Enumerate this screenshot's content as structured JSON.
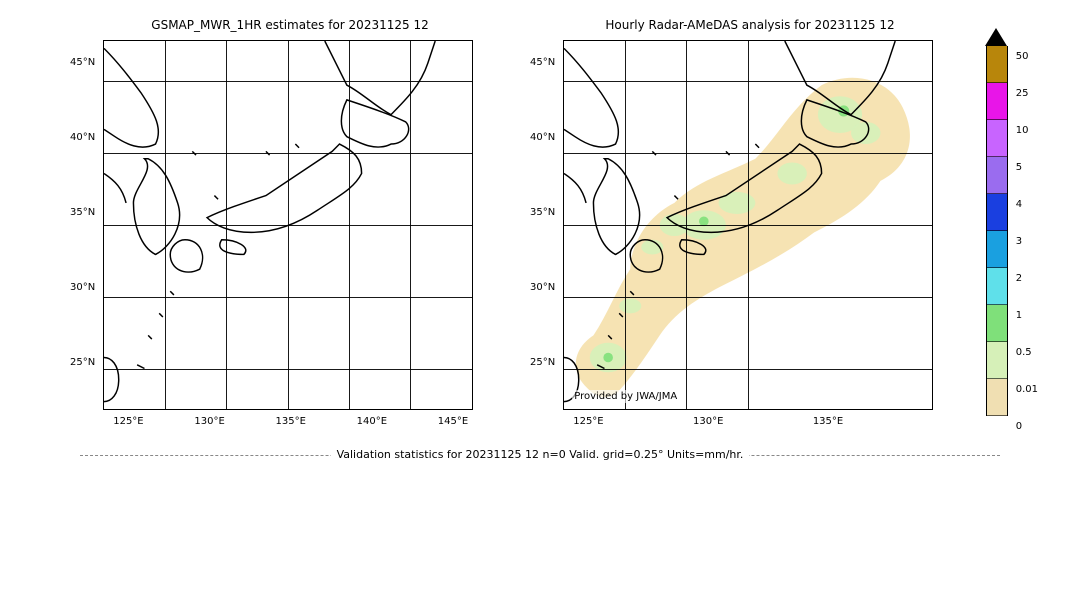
{
  "chart_data": [
    {
      "type": "heatmap",
      "id": "gsmap",
      "title": "GSMAP_MWR_1HR estimates for 20231125 12",
      "region": "Japan and surrounding seas",
      "lat_range_deg": [
        22.5,
        47.5
      ],
      "lon_range_deg": [
        120.0,
        150.0
      ],
      "lat_ticks": [
        "45°N",
        "40°N",
        "35°N",
        "30°N",
        "25°N"
      ],
      "lon_ticks": [
        "125°E",
        "130°E",
        "135°E",
        "140°E",
        "145°E"
      ],
      "units": "mm/hr",
      "data_summary": "No precipitation estimated (blank)"
    },
    {
      "type": "heatmap",
      "id": "radar_amedas",
      "title": "Hourly Radar-AMeDAS analysis for 20231125 12",
      "region": "Japan and surrounding seas",
      "lat_range_deg": [
        22.5,
        47.5
      ],
      "lon_range_deg": [
        120.0,
        150.0
      ],
      "lat_ticks": [
        "45°N",
        "40°N",
        "35°N",
        "30°N",
        "25°N"
      ],
      "lon_ticks": [
        "125°E",
        "130°E",
        "135°E"
      ],
      "units": "mm/hr",
      "attribution": "Provided by JWA/JMA",
      "data_summary": "Widespread 0–0.01 mm/hr radar coverage halo over Japan with scattered 0.01–1 mm/hr patches (light green) over western Japan, central Honshu, Hokkaido, and Okinawa",
      "precip_bins": [
        {
          "min": 0,
          "max": 0.01,
          "coverage": "radar domain halo (tan)"
        },
        {
          "min": 0.01,
          "max": 0.5,
          "coverage": "small blobs near Hokkaido W, Chugoku, Kinki, Okinawa"
        },
        {
          "min": 0.5,
          "max": 1,
          "coverage": "trace spots"
        }
      ]
    }
  ],
  "colorbar": {
    "units": "mm/hr",
    "over_color": "#000000",
    "levels": [
      {
        "upper": 50,
        "color": "#b8860b"
      },
      {
        "upper": 25,
        "color": "#e815e8"
      },
      {
        "upper": 10,
        "color": "#c864ff"
      },
      {
        "upper": 5,
        "color": "#9a6cef"
      },
      {
        "upper": 4,
        "color": "#1a3fe0"
      },
      {
        "upper": 3,
        "color": "#1aa0e0"
      },
      {
        "upper": 2,
        "color": "#5fe0ea"
      },
      {
        "upper": 1,
        "color": "#7fe07a"
      },
      {
        "upper": 0.5,
        "color": "#d6f0b8"
      },
      {
        "upper": 0.01,
        "color": "#f0dfb2"
      }
    ],
    "labels": [
      "50",
      "25",
      "10",
      "5",
      "4",
      "3",
      "2",
      "1",
      "0.5",
      "0.01",
      "0"
    ]
  },
  "statline": "Validation statistics for 20231125 12  n=0 Valid. grid=0.25° Units=mm/hr."
}
